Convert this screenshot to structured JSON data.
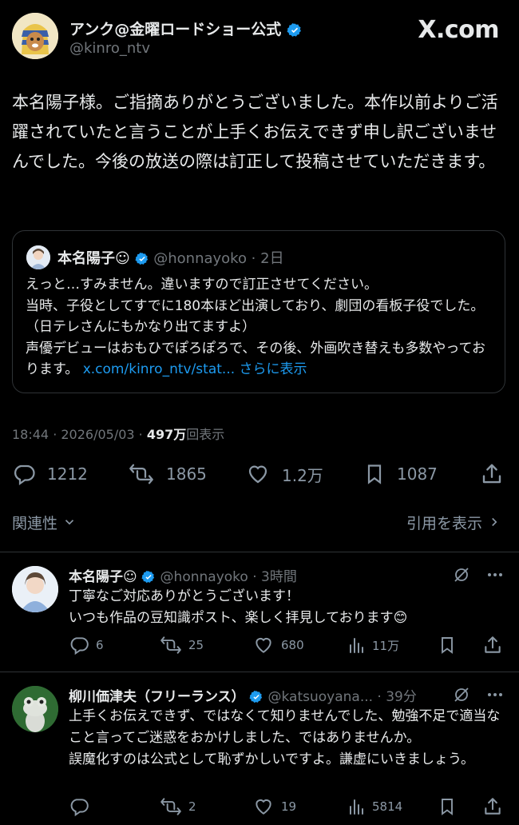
{
  "header": {
    "account_name": "アンク@金曜ロードショー公式",
    "handle": "@kinro_ntv",
    "brand": "X.com"
  },
  "post": {
    "text": "本名陽子様。ご指摘ありがとうございました。本作以前よりご活躍されていたと言うことが上手くお伝えできず申し訳ございませんでした。今後の放送の際は訂正して投稿させていただきます。"
  },
  "quoted": {
    "name": "本名陽子☺︎",
    "handle_time": "@honnayoko · 2日",
    "text": "えっと…すみません。違いますので訂正させてください。\n当時、子役としてすでに180本ほど出演しており、劇団の看板子役でした。（日テレさんにもかなり出てますよ）\n声優デビューはおもひでぽろぽろで、その後、外画吹き替えも多数やっております。",
    "link": "x.com/kinro_ntv/stat...",
    "show_more": "さらに表示"
  },
  "meta": {
    "time_date": "18:44 · 2026/05/03 · ",
    "views": "497万",
    "views_label": "回表示"
  },
  "actions": {
    "replies": "1212",
    "reposts": "1865",
    "likes": "1.2万",
    "bookmarks": "1087"
  },
  "sort": {
    "label": "関連性",
    "view_quotes": "引用を表示"
  },
  "replies": [
    {
      "name": "本名陽子☺︎",
      "handle_time": "@honnayoko · 3時間",
      "text": "丁寧なご対応ありがとうございます！\nいつも作品の豆知識ポスト、楽しく拝見しております😊",
      "reply_count": "6",
      "repost_count": "25",
      "like_count": "680",
      "view_count": "11万"
    },
    {
      "name": "柳川価津夫（フリーランス）",
      "handle_time": "@katsuoyana... · 39分",
      "text": "上手くお伝えできず、ではなくて知りませんでした、勉強不足で適当なこと言ってご迷惑をおかけしました、ではありませんか。\n誤魔化すのは公式として恥ずかしいですよ。謙虚にいきましょう。",
      "reply_count": "",
      "repost_count": "2",
      "like_count": "19",
      "view_count": "5814"
    }
  ],
  "colors": {
    "background": "#000000",
    "text": "#e7e9ea",
    "muted": "#71767b",
    "link": "#1d9bf0",
    "verified": "#1d9bf0",
    "border": "#2f3336"
  }
}
